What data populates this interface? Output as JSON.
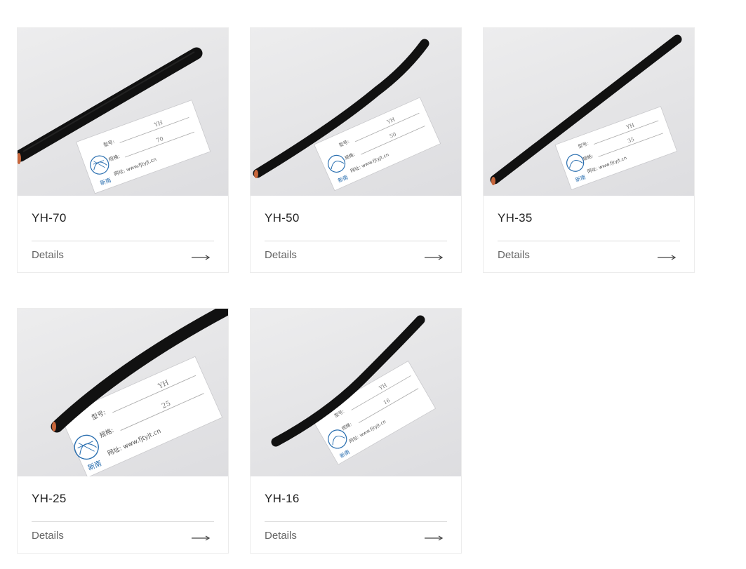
{
  "products": [
    {
      "title": "YH-70",
      "details_label": "Details",
      "label_model": "型号:",
      "label_spec": "规格:",
      "label_site": "网址: www.fjtyjt.cn",
      "model_value": "YH",
      "spec_value": "70",
      "logo_text": "新南"
    },
    {
      "title": "YH-50",
      "details_label": "Details",
      "label_model": "型号:",
      "label_spec": "规格:",
      "label_site": "网址: www.fjtyjt.cn",
      "model_value": "YH",
      "spec_value": "50",
      "logo_text": "新南"
    },
    {
      "title": "YH-35",
      "details_label": "Details",
      "label_model": "型号:",
      "label_spec": "规格:",
      "label_site": "网址: www.fjtyjt.cn",
      "model_value": "YH",
      "spec_value": "35",
      "logo_text": "新南"
    },
    {
      "title": "YH-25",
      "details_label": "Details",
      "label_model": "型号:",
      "label_spec": "规格:",
      "label_site": "网址: www.fjtyjt.cn",
      "model_value": "YH",
      "spec_value": "25",
      "logo_text": "新南"
    },
    {
      "title": "YH-16",
      "details_label": "Details",
      "label_model": "型号:",
      "label_spec": "规格:",
      "label_site": "网址: www.fjtyjt.cn",
      "model_value": "YH",
      "spec_value": "16",
      "logo_text": "新南"
    }
  ],
  "arrow_icon": "long-right-arrow-icon"
}
